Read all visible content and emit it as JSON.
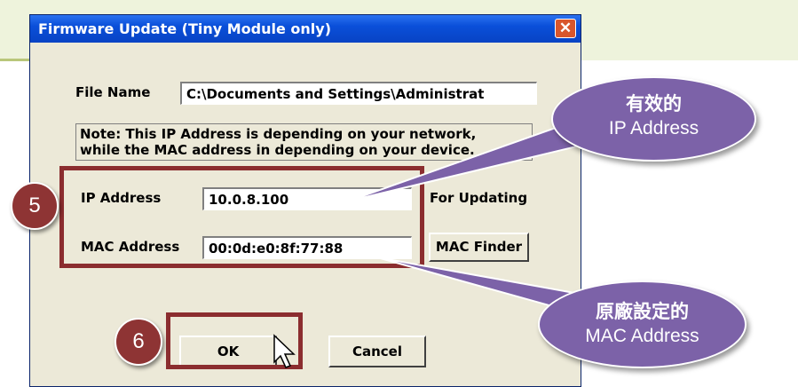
{
  "window": {
    "title": "Firmware Update (Tiny Module only)",
    "close_glyph": "✕"
  },
  "file": {
    "label": "File Name",
    "value": "C:\\Documents and Settings\\Administrat"
  },
  "note": {
    "line1": "Note: This IP Address is depending on your network,",
    "line2": "while the  MAC address in depending on your device."
  },
  "ip": {
    "label": "IP Address",
    "value": "10.0.8.100",
    "hint": "For Updating"
  },
  "mac": {
    "label": "MAC Address",
    "value": "00:0d:e0:8f:77:88",
    "finder": "MAC Finder"
  },
  "buttons": {
    "ok": "OK",
    "cancel": "Cancel"
  },
  "annotations": {
    "step5": "5",
    "step6": "6",
    "callout_ip": {
      "line1": "有效的",
      "line2": "IP Address"
    },
    "callout_mac": {
      "line1": "原廠設定的",
      "line2": "MAC Address"
    }
  },
  "colors": {
    "title_bar": "#0a4fd9",
    "annotation_red": "#8b2d2f",
    "callout_purple": "#7c62a8"
  }
}
